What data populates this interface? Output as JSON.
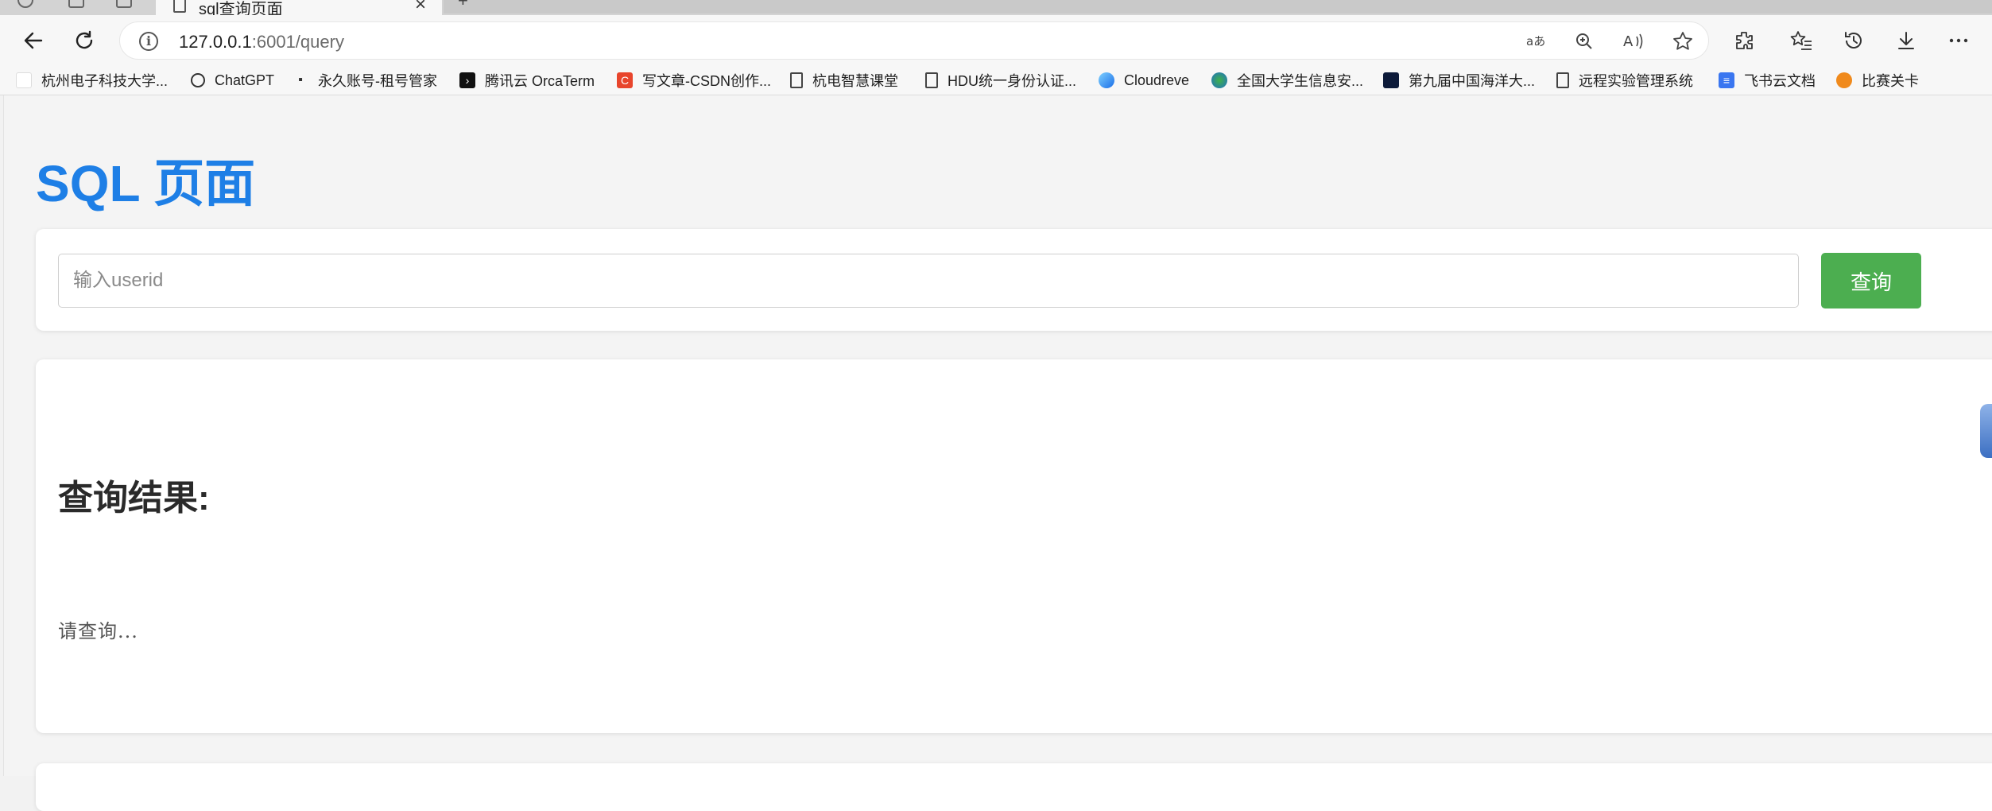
{
  "tab": {
    "title": "sql查询页面",
    "close_glyph": "×",
    "new_tab_glyph": "+"
  },
  "toolbar": {
    "back_icon": "back-arrow-icon",
    "refresh_icon": "refresh-icon",
    "url_host": "127.0.0.1",
    "url_path": ":6001/query",
    "addr_icons": [
      "read-aloud-language-icon",
      "zoom-icon",
      "read-aloud-icon",
      "favorite-star-icon"
    ],
    "right_icons": [
      "extensions-icon",
      "favorites-icon",
      "history-icon",
      "downloads-icon",
      "more-icon"
    ]
  },
  "bookmarks": [
    {
      "label": "杭州电子科技大学...",
      "icon": "page-icon"
    },
    {
      "label": "ChatGPT",
      "icon": "chatgpt-icon"
    },
    {
      "label": "永久账号-租号管家",
      "icon": "terminal-icon"
    },
    {
      "label": "腾讯云 OrcaTerm",
      "icon": "orcaterm-icon"
    },
    {
      "label": "写文章-CSDN创作...",
      "icon": "csdn-icon"
    },
    {
      "label": "杭电智慧课堂",
      "icon": "page-icon"
    },
    {
      "label": "HDU统一身份认证...",
      "icon": "page-icon"
    },
    {
      "label": "Cloudreve",
      "icon": "cloudreve-icon"
    },
    {
      "label": "全国大学生信息安...",
      "icon": "globe-icon"
    },
    {
      "label": "第九届中国海洋大...",
      "icon": "ocean-icon"
    },
    {
      "label": "远程实验管理系统",
      "icon": "page-icon"
    },
    {
      "label": "飞书云文档",
      "icon": "feishu-doc-icon"
    },
    {
      "label": "比赛关卡",
      "icon": "game-icon"
    }
  ],
  "page": {
    "title": "SQL 页面",
    "search": {
      "placeholder": "输入userid",
      "value": "",
      "button_label": "查询"
    },
    "result": {
      "heading": "查询结果:",
      "text": "请查询..."
    }
  },
  "colors": {
    "title_blue": "#1e7fe6",
    "button_green": "#4cae50",
    "page_bg": "#f4f4f4"
  }
}
